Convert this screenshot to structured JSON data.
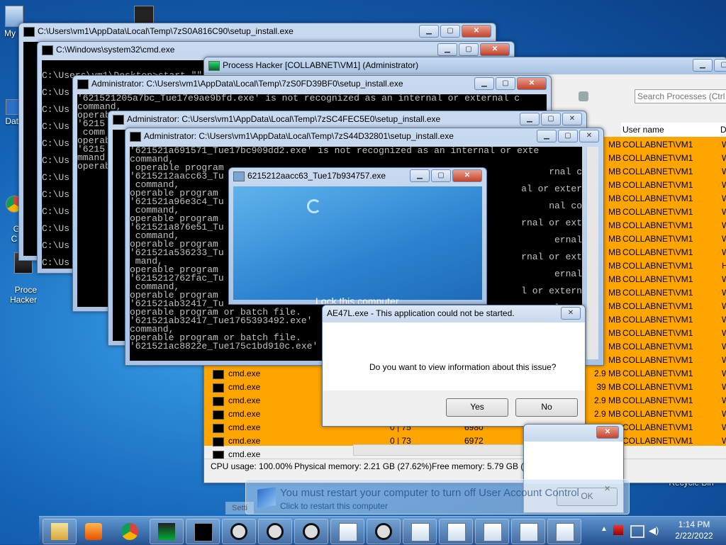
{
  "desktop_icons": {
    "mycomputer": "My C",
    "data": "Data",
    "g": "G\nC",
    "process_hacker": "Proce\nHacker",
    "recycle_bin": "Recycle Bin"
  },
  "win_setup1": {
    "title": "C:\\Users\\vm1\\AppData\\Local\\Temp\\7zS0A816C90\\setup_install.exe"
  },
  "win_cmd": {
    "title": "C:\\Windows\\system32\\cmd.exe",
    "lines": "C:\\Users\\vm1\\Desktop>start \"\"\nC:\\Us\nC:\\Us\nC:\\Us\nC:\\Us\nC:\\Us\nC:\\Us\nC:\\Us\nC:\\Us\nC:\\Us\nC:\\Us\nC:\\Us\nC:\\Us"
  },
  "win_ph": {
    "title": "Process Hacker [COLLABNET\\VM1] (Administrator)",
    "search_placeholder": "Search Processes (Ctrl",
    "col_user": "User name",
    "col_d": "D",
    "user_values": [
      "COLLABNET\\VM1",
      "COLLABNET\\VM1",
      "COLLABNET\\VM1",
      "COLLABNET\\VM1",
      "COLLABNET\\VM1",
      "COLLABNET\\VM1",
      "COLLABNET\\VM1",
      "COLLABNET\\VM1",
      "COLLABNET\\VM1",
      "COLLABNET\\VM1",
      "COLLABNET\\VM1",
      "COLLABNET\\VM1",
      "COLLABNET\\VM1",
      "COLLABNET\\VM1",
      "COLLABNET\\VM1",
      "COLLABNET\\VM1",
      "COLLABNET\\VM1",
      "COLLABNET\\VM1",
      "COLLABNET\\VM1",
      "COLLABNET\\VM1",
      "COLLABNET\\VM1",
      "COLLABNET\\VM1",
      "COLLABNET\\VM1"
    ],
    "mem_col": [
      "MB",
      "MB",
      "MB",
      "MB",
      "MB",
      "MB",
      "MB",
      "MB",
      "MB",
      "MB",
      "MB",
      "MB",
      "MB",
      "MB",
      "MB",
      "MB",
      "MB",
      "2.9 MB",
      "39 MB",
      "2.9 MB",
      "2.9 MB",
      "2.9 MB",
      ""
    ],
    "d_col": [
      "W",
      "W",
      "W",
      "W",
      "W",
      "W",
      "W",
      "W",
      "W",
      "H",
      "W",
      "W",
      "W",
      "W",
      "W",
      "W",
      "W",
      "W",
      "W",
      "W",
      "W",
      "W",
      "W"
    ],
    "cmd_rows": [
      {
        "name": "cmd.exe",
        "cpu": "",
        "pid": ""
      },
      {
        "name": "cmd.exe",
        "cpu": "",
        "pid": ""
      },
      {
        "name": "cmd.exe",
        "cpu": "",
        "pid": ""
      },
      {
        "name": "cmd.exe",
        "cpu": "",
        "pid": ""
      },
      {
        "name": "cmd.exe",
        "cpu": "0 | 75",
        "pid": "6980"
      },
      {
        "name": "cmd.exe",
        "cpu": "0 | 73",
        "pid": "6972"
      },
      {
        "name": "cmd.exe",
        "cpu": "",
        "pid": ""
      }
    ],
    "status_cpu": "CPU usage: 100.00%",
    "status_phys": "Physical memory: 2.21 GB (27.62%)",
    "status_free": "Free memory: 5.79 GB (7"
  },
  "win_admin1": {
    "title": "Administrator: C:\\Users\\vm1\\AppData\\Local\\Temp\\7zS0FD39BF0\\setup_install.exe",
    "lines": "'621521205a7bc_Tue17e9ae9bfd.exe' is not recognized as an internal or external c\ncommand,\noperabl\n'6215\n comm\noperab\n'6215\nmmand\noperab"
  },
  "win_admin2": {
    "title": "Administrator: C:\\Users\\vm1\\AppData\\Local\\Temp\\7zSC4FEC5E0\\setup_install.exe"
  },
  "win_admin3": {
    "title": "Administrator: C:\\Users\\vm1\\AppData\\Local\\Temp\\7zS44D32801\\setup_install.exe",
    "lines": "'621521a691571_Tue17bc909dd2.exe' is not recognized as an internal or exte\ncommand,\n operable program\n'6215212aacc63_Tu\n command,\noperable program\n'621521a96e3c4_Tu\n command,\noperable program\n'621521a876e51_Tu\n command,\noperable program\n'621521a536233_Tu\n mand,\noperable program\n'6215212762fac_Tu\n command,\noperable program\n'621521ab32417_Tu\noperable program or batch file.\n'621521ab32417_Tue1765393492.exe'\ncommand,\noperable program or batch file.\n'621521ac8822e_Tue175c1bd910c.exe'",
    "right_lines": "rnal c\nal or exter\nnal co\nrnal or ext\nernal\nrnal or ext\nernal\nl or extern\nal com\nernal or ex\nternal"
  },
  "win_lock": {
    "title": "6215212aacc63_Tue17b934757.exe",
    "lock_text": "Lock this computer"
  },
  "dlg_error": {
    "title": "AE47L.exe - This application could not be started.",
    "message": "Do you want to view information about this issue?",
    "yes": "Yes",
    "no": "No"
  },
  "dlg_small": {
    "ok": "OK"
  },
  "uac_balloon": {
    "line1": "You must restart your computer to turn off User Account Control",
    "line2": "Click to restart this computer",
    "fragment": "Setti"
  },
  "clock": {
    "time": "1:14 PM",
    "date": "2/22/2022"
  }
}
